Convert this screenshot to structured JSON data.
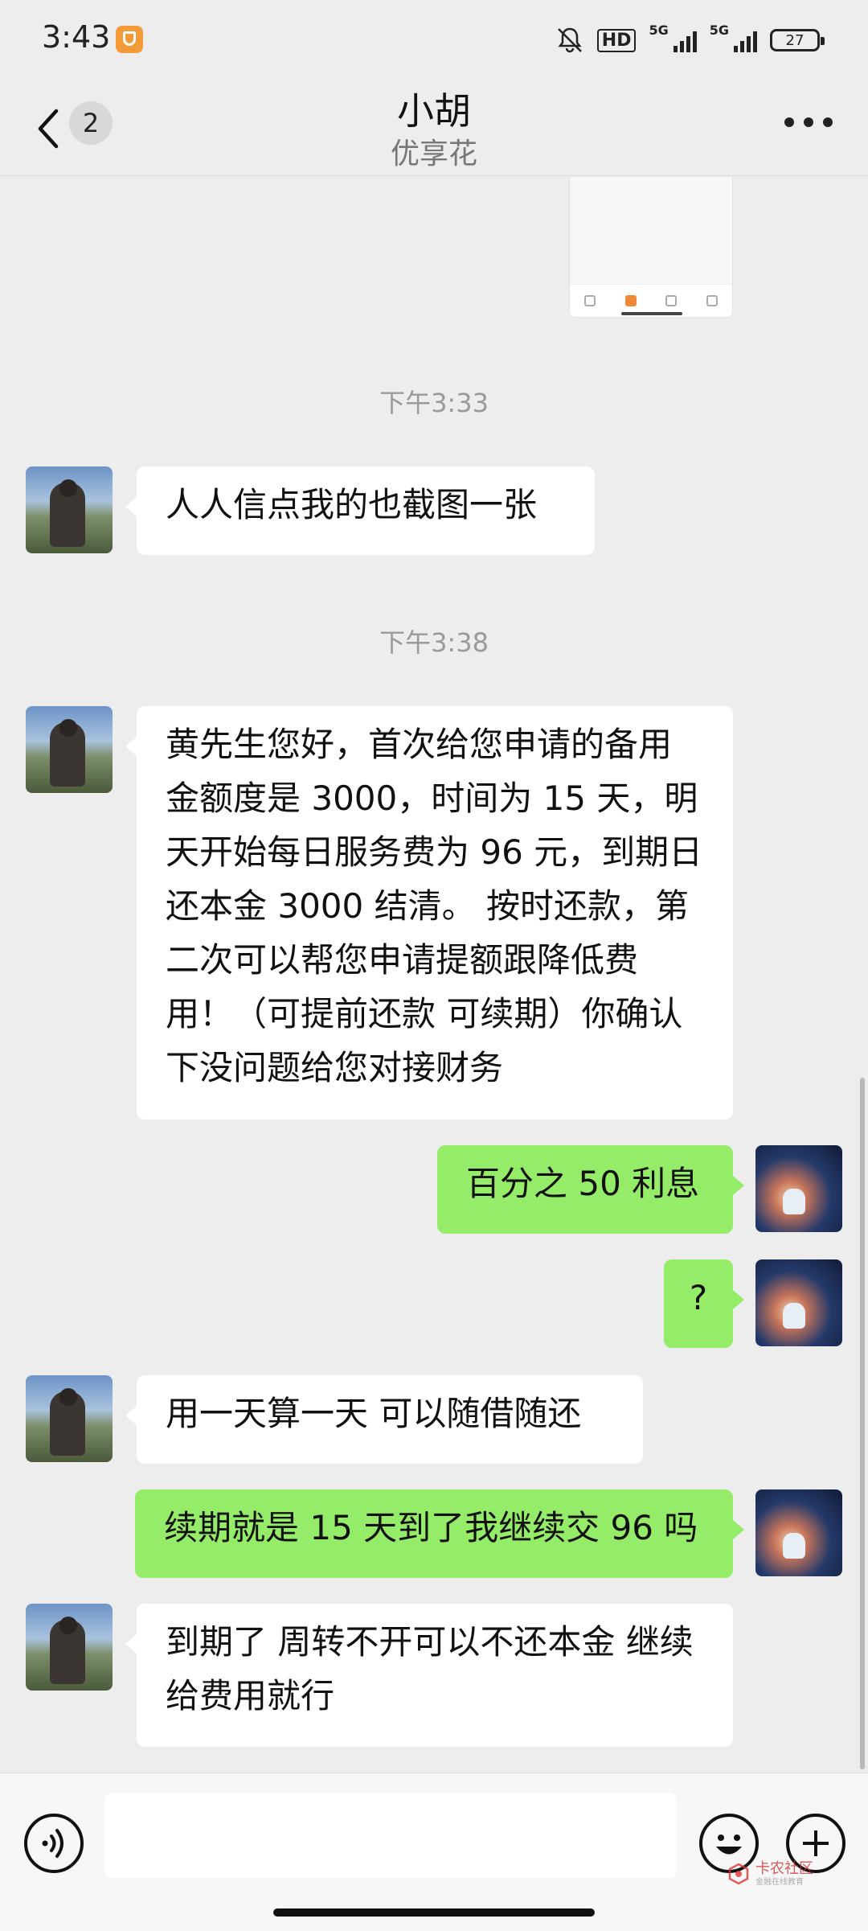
{
  "status_bar": {
    "time": "3:43",
    "hd_label": "HD",
    "network_1": "5G",
    "network_2": "5G",
    "battery": "27",
    "icons": [
      "shield-icon",
      "mute-bell-icon",
      "hd-voice-icon",
      "signal-icon",
      "battery-icon"
    ]
  },
  "header": {
    "back_icon": "chevron-left-icon",
    "unread_count": "2",
    "title": "小胡",
    "subtitle": "优享花",
    "more_icon": "more-dots-icon"
  },
  "chat": {
    "timestamps": [
      "下午3:33",
      "下午3:38"
    ],
    "messages": [
      {
        "side": "left",
        "text": "人人信点我的也截图一张"
      },
      {
        "side": "left",
        "text": "黄先生您好，首次给您申请的备用金额度是 3000，时间为 15 天，明天开始每日服务费为 96 元，到期日还本金 3000 结清。 按时还款，第二次可以帮您申请提额跟降低费用！（可提前还款 可续期）你确认下没问题给您对接财务"
      },
      {
        "side": "right",
        "text": "百分之 50 利息"
      },
      {
        "side": "right",
        "text": "?"
      },
      {
        "side": "left",
        "text": "用一天算一天 可以随借随还"
      },
      {
        "side": "right",
        "text": "续期就是 15 天到了我继续交 96 吗"
      },
      {
        "side": "left",
        "text": "到期了 周转不开可以不还本金 继续给费用就行"
      }
    ]
  },
  "input_bar": {
    "placeholder": "",
    "voice_icon": "voice-icon",
    "emoji_icon": "emoji-icon",
    "plus_icon": "plus-icon"
  },
  "watermark": {
    "main": "卡农社区",
    "sub": "金融在线教育"
  },
  "colors": {
    "background": "#ededed",
    "bubble_sent": "#95ec69",
    "bubble_received": "#ffffff"
  }
}
